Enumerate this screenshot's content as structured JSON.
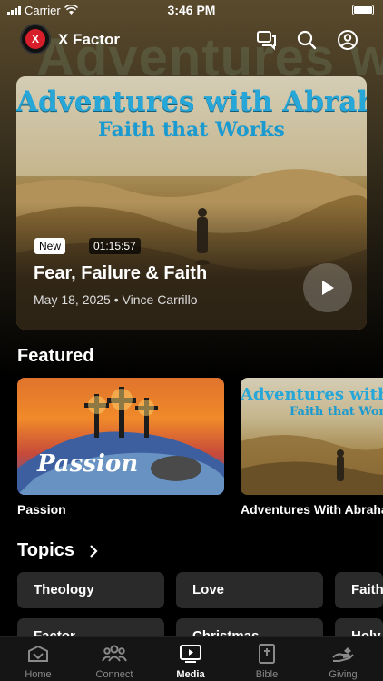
{
  "status": {
    "carrier": "Carrier",
    "time": "3:46 PM"
  },
  "header": {
    "app_name": "X Factor",
    "logo_text": "X"
  },
  "hero": {
    "artwork_title": "Adventures with Abraham",
    "artwork_subtitle": "Faith that Works",
    "badge": "New",
    "duration": "01:15:57",
    "title": "Fear, Failure & Faith",
    "date": "May 18, 2025",
    "separator": "•",
    "speaker": "Vince Carrillo"
  },
  "featured": {
    "title": "Featured",
    "items": [
      {
        "label": "Passion",
        "art_text": "Passion"
      },
      {
        "label": "Adventures With Abraham",
        "art_title": "Adventures with Abraham",
        "art_subtitle": "Faith that Works"
      }
    ]
  },
  "topics": {
    "title": "Topics",
    "chips": [
      "Theology",
      "Love",
      "Faith",
      "Factor",
      "Christmas",
      "Holy"
    ]
  },
  "tabs": [
    {
      "label": "Home",
      "icon": "home-icon",
      "active": false
    },
    {
      "label": "Connect",
      "icon": "people-icon",
      "active": false
    },
    {
      "label": "Media",
      "icon": "play-screen-icon",
      "active": true
    },
    {
      "label": "Bible",
      "icon": "bible-icon",
      "active": false
    },
    {
      "label": "Giving",
      "icon": "giving-hand-icon",
      "active": false
    }
  ],
  "colors": {
    "accent_title": "#27a6d8",
    "logo_red": "#d81e2a",
    "chip_bg": "#2a2a2a"
  }
}
